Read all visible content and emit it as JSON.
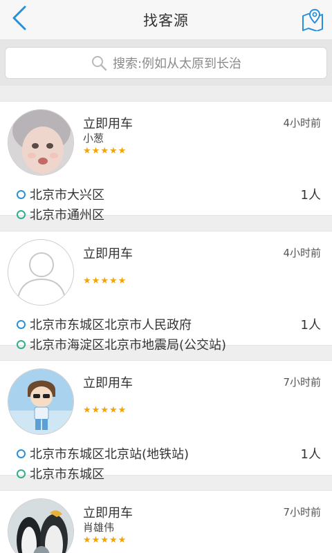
{
  "header": {
    "title": "找客源",
    "back_icon": "chevron-left-icon",
    "map_icon": "map-pin-icon",
    "accent": "#2a8fd9"
  },
  "search": {
    "placeholder": "搜索:例如从太原到长治",
    "icon": "search-icon"
  },
  "items": [
    {
      "title": "立即用车",
      "time": "4小时前",
      "name": "小葱",
      "rating": 5,
      "avatar": "baby-photo",
      "from": "北京市大兴区",
      "to": "北京市通州区",
      "count": "1人"
    },
    {
      "title": "立即用车",
      "time": "4小时前",
      "name": "",
      "rating": 5,
      "avatar": "default-user",
      "from": "北京市东城区北京市人民政府",
      "to": "北京市海淀区北京市地震局(公交站)",
      "count": "1人"
    },
    {
      "title": "立即用车",
      "time": "7小时前",
      "name": "",
      "rating": 5,
      "avatar": "cartoon-boy",
      "from": "北京市东城区北京站(地铁站)",
      "to": "北京市东城区",
      "count": "1人"
    },
    {
      "title": "立即用车",
      "time": "7小时前",
      "name": "肖雄伟",
      "rating": 5,
      "avatar": "penguins-photo",
      "from": "",
      "to": "",
      "count": ""
    }
  ],
  "colors": {
    "from_dot": "#2c8fd6",
    "to_dot": "#2fae8e",
    "star": "#f5a300"
  }
}
